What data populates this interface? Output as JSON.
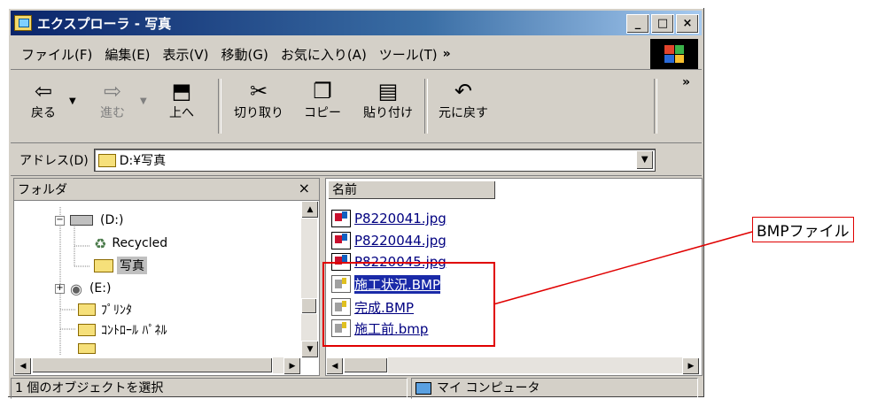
{
  "window": {
    "title": "エクスプローラ - 写真",
    "buttons": {
      "minimize": "_",
      "maximize": "□",
      "close": "×"
    }
  },
  "menu": {
    "items": [
      "ファイル(F)",
      "編集(E)",
      "表示(V)",
      "移動(G)",
      "お気に入り(A)",
      "ツール(T)"
    ],
    "more": "»"
  },
  "toolbar": {
    "back": "戻る",
    "forward": "進む",
    "up": "上へ",
    "cut": "切り取り",
    "copy": "コピー",
    "paste": "貼り付け",
    "undo": "元に戻す",
    "more": "»"
  },
  "address": {
    "label": "アドレス(D)",
    "value": "D:¥写真"
  },
  "folders": {
    "header": "フォルダ",
    "close": "×",
    "items": [
      "(D:)",
      "Recycled",
      "写真",
      "(E:)",
      "ﾌﾟﾘﾝﾀ",
      "ｺﾝﾄﾛｰﾙ ﾊﾟﾈﾙ"
    ]
  },
  "files": {
    "column_name": "名前",
    "items": [
      "P8220041.jpg",
      "P8220044.jpg",
      "P8220045.jpg",
      "施工状況.BMP",
      "完成.BMP",
      "施工前.bmp"
    ],
    "selected_index": 3
  },
  "status": {
    "left": "1 個のオブジェクトを選択",
    "right": "マイ コンピュータ"
  },
  "annotation": {
    "label": "BMPファイル",
    "color": "#e00000"
  }
}
